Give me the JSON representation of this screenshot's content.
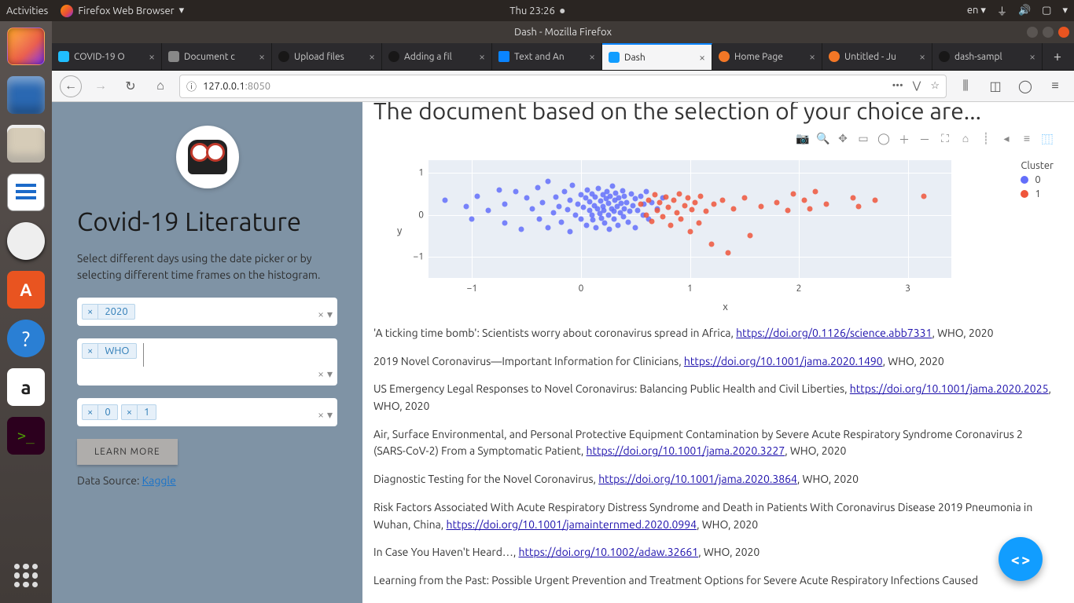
{
  "gnome": {
    "activities": "Activities",
    "app": "Firefox Web Browser",
    "clock": "Thu 23:26",
    "lang": "en"
  },
  "window_title": "Dash - Mozilla Firefox",
  "tabs": [
    {
      "label": "COVID-19 O",
      "type": "k"
    },
    {
      "label": "Document c",
      "type": "doc"
    },
    {
      "label": "Upload files",
      "type": "gh"
    },
    {
      "label": "Adding a fil",
      "type": "gh"
    },
    {
      "label": "Text and An",
      "type": "plotly"
    },
    {
      "label": "Dash",
      "type": "dash",
      "active": true
    },
    {
      "label": "Home Page",
      "type": "jup"
    },
    {
      "label": "Untitled - Ju",
      "type": "jup"
    },
    {
      "label": "dash-sampl",
      "type": "gh"
    }
  ],
  "url": {
    "host": "127.0.0.1",
    "port": ":8050"
  },
  "sidebar": {
    "title": "Covid-19 Literature",
    "desc": "Select different days using the date picker or by selecting different time frames on the histogram.",
    "dd_year": [
      "2020"
    ],
    "dd_source": [
      "WHO"
    ],
    "dd_cluster": [
      "0",
      "1"
    ],
    "learn": "LEARN MORE",
    "ds_label": "Data Source: ",
    "ds_link": "Kaggle"
  },
  "main_heading": "The document based on the selection of your choice are...",
  "legend": {
    "title": "Cluster",
    "items": [
      "0",
      "1"
    ]
  },
  "axes": {
    "y": "y",
    "x": "x",
    "yticks": [
      "1",
      "0",
      "−1"
    ],
    "xticks": [
      "−1",
      "0",
      "1",
      "2",
      "3"
    ]
  },
  "chart_data": {
    "type": "scatter",
    "xlabel": "x",
    "ylabel": "y",
    "xlim": [
      -1.4,
      3.4
    ],
    "ylim": [
      -1.5,
      1.3
    ],
    "legend_title": "Cluster",
    "series": [
      {
        "name": "0",
        "color": "#636efa",
        "points": [
          [
            -1.25,
            0.35
          ],
          [
            -1.05,
            0.2
          ],
          [
            -1.0,
            -0.1
          ],
          [
            -0.95,
            0.45
          ],
          [
            -0.85,
            0.1
          ],
          [
            -0.75,
            0.6
          ],
          [
            -0.7,
            -0.2
          ],
          [
            -0.7,
            0.25
          ],
          [
            -0.6,
            0.55
          ],
          [
            -0.55,
            -0.35
          ],
          [
            -0.5,
            0.4
          ],
          [
            -0.45,
            0.15
          ],
          [
            -0.4,
            0.65
          ],
          [
            -0.38,
            -0.1
          ],
          [
            -0.35,
            0.3
          ],
          [
            -0.3,
            0.8
          ],
          [
            -0.3,
            -0.3
          ],
          [
            -0.25,
            0.05
          ],
          [
            -0.23,
            0.42
          ],
          [
            -0.2,
            0.2
          ],
          [
            -0.18,
            -0.18
          ],
          [
            -0.15,
            0.55
          ],
          [
            -0.12,
            0.12
          ],
          [
            -0.1,
            0.35
          ],
          [
            -0.1,
            -0.4
          ],
          [
            -0.08,
            0.7
          ],
          [
            -0.05,
            0.0
          ],
          [
            -0.03,
            0.25
          ],
          [
            0.0,
            0.48
          ],
          [
            0.0,
            -0.1
          ],
          [
            0.02,
            0.18
          ],
          [
            0.04,
            0.4
          ],
          [
            0.05,
            -0.25
          ],
          [
            0.06,
            0.6
          ],
          [
            0.08,
            0.1
          ],
          [
            0.08,
            0.32
          ],
          [
            0.1,
            0.0
          ],
          [
            0.1,
            0.5
          ],
          [
            0.11,
            -0.12
          ],
          [
            0.12,
            0.22
          ],
          [
            0.13,
            0.42
          ],
          [
            0.14,
            -0.3
          ],
          [
            0.15,
            0.15
          ],
          [
            0.16,
            0.62
          ],
          [
            0.17,
            0.03
          ],
          [
            0.18,
            0.33
          ],
          [
            0.19,
            -0.08
          ],
          [
            0.2,
            0.48
          ],
          [
            0.2,
            0.2
          ],
          [
            0.21,
            0.1
          ],
          [
            0.22,
            -0.2
          ],
          [
            0.23,
            0.38
          ],
          [
            0.24,
            0.55
          ],
          [
            0.25,
            0.0
          ],
          [
            0.25,
            0.27
          ],
          [
            0.26,
            -0.35
          ],
          [
            0.27,
            0.45
          ],
          [
            0.28,
            0.15
          ],
          [
            0.29,
            0.68
          ],
          [
            0.3,
            0.08
          ],
          [
            0.3,
            -0.1
          ],
          [
            0.31,
            0.35
          ],
          [
            0.32,
            0.52
          ],
          [
            0.33,
            0.2
          ],
          [
            0.34,
            -0.25
          ],
          [
            0.35,
            0.4
          ],
          [
            0.36,
            0.05
          ],
          [
            0.37,
            0.28
          ],
          [
            0.38,
            0.58
          ],
          [
            0.39,
            -0.05
          ],
          [
            0.4,
            0.15
          ],
          [
            0.4,
            0.45
          ],
          [
            0.42,
            0.3
          ],
          [
            0.43,
            -0.18
          ],
          [
            0.45,
            0.08
          ],
          [
            0.46,
            0.5
          ],
          [
            0.48,
            0.22
          ],
          [
            0.5,
            0.38
          ],
          [
            0.5,
            -0.3
          ],
          [
            0.52,
            0.1
          ],
          [
            0.55,
            0.45
          ],
          [
            0.57,
            0.0
          ],
          [
            0.58,
            0.25
          ],
          [
            0.6,
            0.55
          ],
          [
            0.62,
            -0.1
          ],
          [
            0.65,
            0.3
          ],
          [
            0.7,
            0.15
          ],
          [
            0.75,
            0.4
          ]
        ]
      },
      {
        "name": "1",
        "color": "#ef553b",
        "points": [
          [
            0.55,
            0.25
          ],
          [
            0.6,
            0.0
          ],
          [
            0.62,
            0.35
          ],
          [
            0.65,
            -0.15
          ],
          [
            0.68,
            0.48
          ],
          [
            0.7,
            0.1
          ],
          [
            0.72,
            0.3
          ],
          [
            0.75,
            -0.05
          ],
          [
            0.78,
            0.42
          ],
          [
            0.8,
            0.18
          ],
          [
            0.82,
            -0.25
          ],
          [
            0.85,
            0.35
          ],
          [
            0.88,
            0.05
          ],
          [
            0.9,
            0.5
          ],
          [
            0.92,
            -0.1
          ],
          [
            0.95,
            0.22
          ],
          [
            0.98,
            0.4
          ],
          [
            1.0,
            -0.4
          ],
          [
            1.02,
            0.12
          ],
          [
            1.05,
            0.3
          ],
          [
            1.08,
            -0.2
          ],
          [
            1.1,
            0.45
          ],
          [
            1.15,
            0.08
          ],
          [
            1.2,
            -0.7
          ],
          [
            1.22,
            0.25
          ],
          [
            1.3,
            0.35
          ],
          [
            1.35,
            -0.9
          ],
          [
            1.4,
            0.15
          ],
          [
            1.5,
            0.4
          ],
          [
            1.55,
            -0.5
          ],
          [
            1.65,
            0.2
          ],
          [
            1.8,
            0.3
          ],
          [
            1.9,
            0.1
          ],
          [
            1.95,
            0.5
          ],
          [
            2.05,
            0.35
          ],
          [
            2.1,
            0.15
          ],
          [
            2.15,
            0.55
          ],
          [
            2.25,
            0.25
          ],
          [
            2.5,
            0.4
          ],
          [
            2.55,
            0.2
          ],
          [
            2.7,
            0.35
          ],
          [
            3.15,
            0.45
          ]
        ]
      }
    ]
  },
  "articles": [
    {
      "text": "'A ticking time bomb': Scientists worry about coronavirus spread in Africa, ",
      "link": "https://doi.org/0.1126/science.abb7331",
      "suffix": ", WHO, 2020"
    },
    {
      "text": "2019 Novel Coronavirus—Important Information for Clinicians, ",
      "link": "https://doi.org/10.1001/jama.2020.1490",
      "suffix": ", WHO, 2020"
    },
    {
      "text": "US Emergency Legal Responses to Novel Coronavirus: Balancing Public Health and Civil Liberties, ",
      "link": "https://doi.org/10.1001/jama.2020.2025",
      "suffix": ", WHO, 2020"
    },
    {
      "text": "Air, Surface Environmental, and Personal Protective Equipment Contamination by Severe Acute Respiratory Syndrome Coronavirus 2 (SARS-CoV-2) From a Symptomatic Patient, ",
      "link": "https://doi.org/10.1001/jama.2020.3227",
      "suffix": ", WHO, 2020"
    },
    {
      "text": "Diagnostic Testing for the Novel Coronavirus, ",
      "link": "https://doi.org/10.1001/jama.2020.3864",
      "suffix": ", WHO, 2020"
    },
    {
      "text": "Risk Factors Associated With Acute Respiratory Distress Syndrome and Death in Patients With Coronavirus Disease 2019 Pneumonia in Wuhan, China, ",
      "link": "https://doi.org/10.1001/jamainternmed.2020.0994",
      "suffix": ", WHO, 2020"
    },
    {
      "text": "In Case You Haven't Heard…, ",
      "link": "https://doi.org/10.1002/adaw.32661",
      "suffix": ", WHO, 2020"
    },
    {
      "text": "Learning from the Past: Possible Urgent Prevention and Treatment Options for Severe Acute Respiratory Infections Caused",
      "link": "",
      "suffix": ""
    }
  ]
}
